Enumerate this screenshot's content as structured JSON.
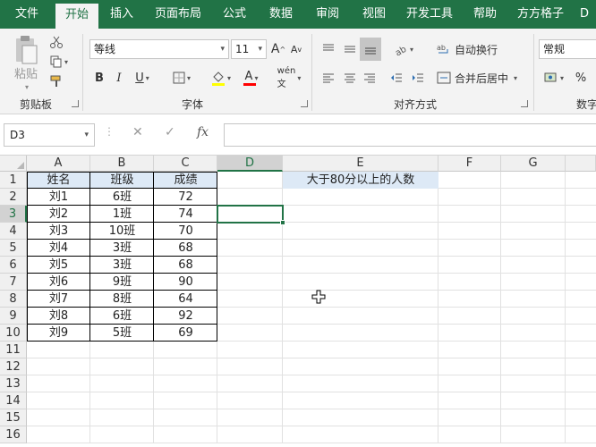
{
  "ribbon": {
    "tabs": [
      "文件",
      "开始",
      "插入",
      "页面布局",
      "公式",
      "数据",
      "审阅",
      "视图",
      "开发工具",
      "帮助",
      "方方格子",
      "D"
    ],
    "active_tab_index": 1,
    "clipboard": {
      "paste_label": "粘贴",
      "group_label": "剪贴板"
    },
    "font": {
      "font_name": "等线",
      "font_size": "11",
      "bold": "B",
      "italic": "I",
      "underline": "U",
      "group_label": "字体",
      "grow": "A",
      "shrink": "A",
      "color_letter": "A",
      "font_color": "#ff0000",
      "highlight_color": "#ffff00"
    },
    "alignment": {
      "wrap_text": "自动换行",
      "merge_center": "合并后居中",
      "group_label": "对齐方式"
    },
    "number": {
      "format": "常规",
      "percent": "%",
      "group_label_partial": "数字"
    }
  },
  "formula_bar": {
    "name_box": "D3",
    "cancel": "✕",
    "enter": "✓",
    "fx": "fx",
    "content": ""
  },
  "sheet": {
    "columns": [
      "A",
      "B",
      "C",
      "D",
      "E",
      "F",
      "G"
    ],
    "rows": [
      "1",
      "2",
      "3",
      "4",
      "5",
      "6",
      "7",
      "8",
      "9",
      "10",
      "11",
      "12",
      "13",
      "14",
      "15",
      "16"
    ],
    "headers": [
      "姓名",
      "班级",
      "成绩"
    ],
    "data": [
      [
        "刘1",
        "6班",
        "72"
      ],
      [
        "刘2",
        "1班",
        "74"
      ],
      [
        "刘3",
        "10班",
        "70"
      ],
      [
        "刘4",
        "3班",
        "68"
      ],
      [
        "刘5",
        "3班",
        "68"
      ],
      [
        "刘6",
        "9班",
        "90"
      ],
      [
        "刘7",
        "8班",
        "64"
      ],
      [
        "刘8",
        "6班",
        "92"
      ],
      [
        "刘9",
        "5班",
        "69"
      ]
    ],
    "e1_label": "大于80分以上的人数",
    "selected_cell": "D3",
    "header_fill": "#dde9f6",
    "accent": "#217346"
  }
}
